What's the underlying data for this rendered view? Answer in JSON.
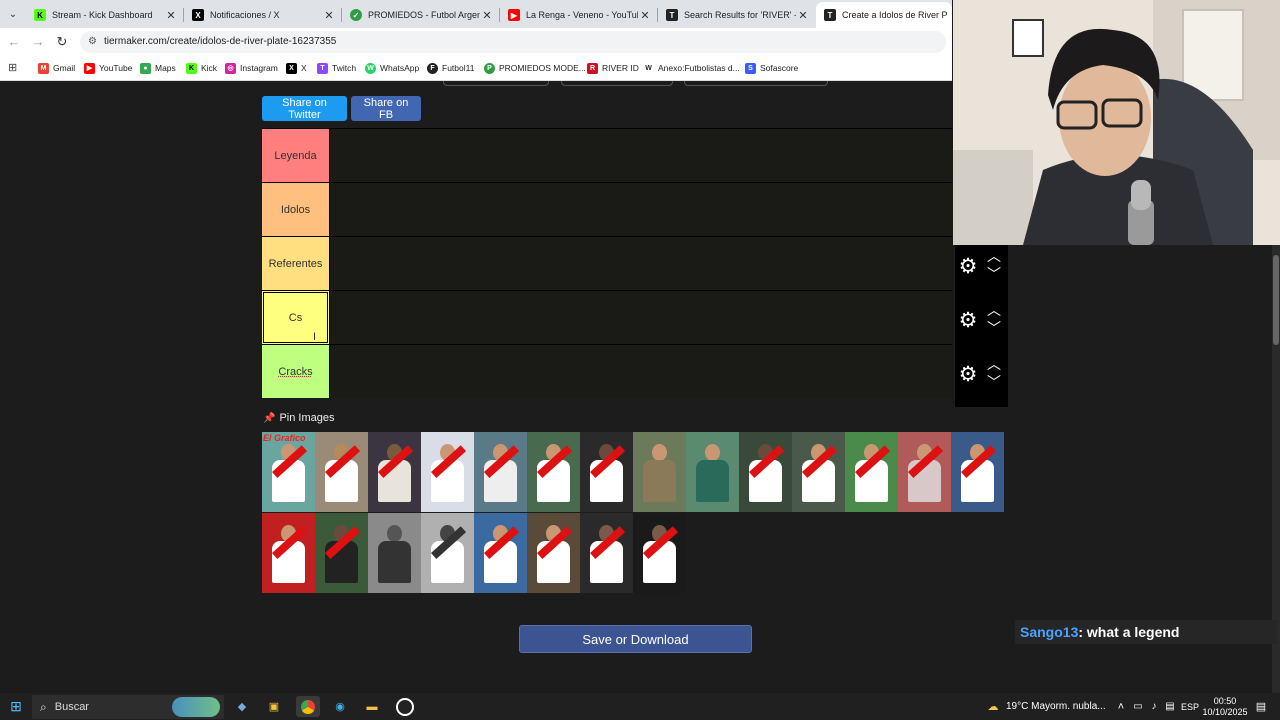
{
  "tabs": [
    {
      "title": "Stream - Kick Dashboard",
      "icon": "kick-icon",
      "color": "#53fc18"
    },
    {
      "title": "Notificaciones / X",
      "icon": "x-icon",
      "color": "#000000"
    },
    {
      "title": "PROMIEDOS - Futbol Argentino",
      "icon": "promiedos-icon",
      "color": "#2e9e44"
    },
    {
      "title": "La Renga - Veneno - YouTube",
      "icon": "youtube-icon",
      "color": "#ff0000"
    },
    {
      "title": "Search Results for 'RIVER' - Tier",
      "icon": "tiermaker-icon",
      "color": "#222222"
    },
    {
      "title": "Create a Idolos de River Plate Tier",
      "icon": "tiermaker-icon",
      "color": "#222222",
      "active": true
    }
  ],
  "url": "tiermaker.com/create/idolos-de-river-plate-16237355",
  "bookmarks": [
    {
      "label": "Gmail",
      "color": "#ea4335",
      "glyph": "M"
    },
    {
      "label": "YouTube",
      "color": "#ff0000",
      "glyph": "▶"
    },
    {
      "label": "Maps",
      "color": "#34a853",
      "glyph": "●"
    },
    {
      "label": "Kick",
      "color": "#53fc18",
      "glyph": "K"
    },
    {
      "label": "Instagram",
      "color": "#d6249f",
      "glyph": "◎"
    },
    {
      "label": "X",
      "color": "#000000",
      "glyph": "X"
    },
    {
      "label": "Twitch",
      "color": "#9146ff",
      "glyph": "T"
    },
    {
      "label": "WhatsApp",
      "color": "#25d366",
      "glyph": "W"
    },
    {
      "label": "Futbol11",
      "color": "#222222",
      "glyph": "F"
    },
    {
      "label": "PROMIEDOS MODE...",
      "color": "#2e9e44",
      "glyph": "P"
    },
    {
      "label": "RIVER ID",
      "color": "#cc1122",
      "glyph": "R"
    },
    {
      "label": "Anexo:Futbolistas d...",
      "color": "#444444",
      "glyph": "W"
    },
    {
      "label": "Sofascore",
      "color": "#3c5cff",
      "glyph": "S"
    }
  ],
  "share": {
    "twitter": "Share on Twitter",
    "fb": "Share on FB"
  },
  "tiers": [
    {
      "label": "Leyenda",
      "color": "#ff7f7f"
    },
    {
      "label": "Idolos",
      "color": "#ffbf7f"
    },
    {
      "label": "Referentes",
      "color": "#ffdf7f"
    },
    {
      "label": "Cs",
      "color": "#ffff7f"
    },
    {
      "label": "Cracks",
      "color": "#bfff7f"
    }
  ],
  "pin_images": "Pin Images",
  "elgrafico": "El Grafico",
  "save_button": "Save or Download",
  "chat": {
    "user": "Sango13",
    "message": " : what a legend"
  },
  "taskbar": {
    "search_placeholder": "Buscar",
    "weather": "19°C  Mayorm. nubla...",
    "lang": "ESP",
    "time": "00:50",
    "date": "10/10/2025"
  },
  "colors": {
    "twitter": "#1d9bf0",
    "fb": "#4267b2",
    "page_bg": "#1c1c1c",
    "chat_user": "#4aa3ff"
  }
}
